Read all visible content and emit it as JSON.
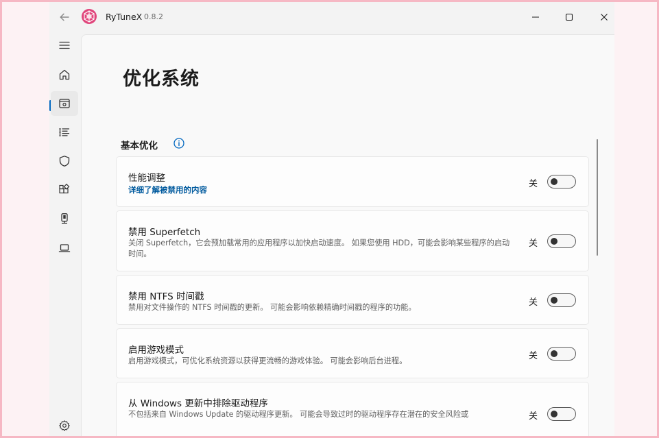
{
  "app": {
    "title": "RyTuneX",
    "version": "0.8.2"
  },
  "nav": {
    "items": [
      {
        "name": "menu-icon"
      },
      {
        "name": "home-icon"
      },
      {
        "name": "optimize-icon",
        "active": true
      },
      {
        "name": "list-icon"
      },
      {
        "name": "shield-icon"
      },
      {
        "name": "apps-icon"
      },
      {
        "name": "device-icon"
      },
      {
        "name": "laptop-icon"
      },
      {
        "name": "gear-icon"
      }
    ]
  },
  "page": {
    "title": "优化系统",
    "section": "基本优化"
  },
  "options": [
    {
      "title": "性能调整",
      "link": "详细了解被禁用的内容",
      "toggle_label": "关"
    },
    {
      "title": "禁用 Superfetch",
      "desc": "关闭 Superfetch，它会预加载常用的应用程序以加快启动速度。 如果您使用 HDD，可能会影响某些程序的启动时间。",
      "toggle_label": "关"
    },
    {
      "title": "禁用 NTFS 时间戳",
      "desc": "禁用对文件操作的 NTFS 时间戳的更新。 可能会影响依赖精确时间戳的程序的功能。",
      "toggle_label": "关"
    },
    {
      "title": "启用游戏模式",
      "desc": "启用游戏模式，可优化系统资源以获得更流畅的游戏体验。 可能会影响后台进程。",
      "toggle_label": "关"
    },
    {
      "title": "从 Windows 更新中排除驱动程序",
      "desc": "不包括来自 Windows Update 的驱动程序更新。 可能会导致过时的驱动程序存在潜在的安全风险或",
      "toggle_label": "关"
    }
  ],
  "colors": {
    "accent": "#0067c0",
    "link": "#005a9e",
    "logo": "#e0457b"
  }
}
